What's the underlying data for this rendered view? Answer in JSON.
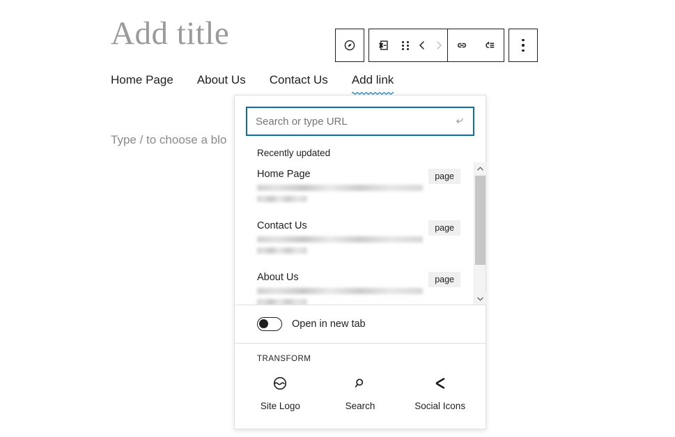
{
  "editor": {
    "post_title_placeholder": "Add title",
    "paragraph_placeholder": "Type / to choose a blo"
  },
  "navigation_block": {
    "items": [
      {
        "label": "Home Page",
        "active": false
      },
      {
        "label": "About Us",
        "active": false
      },
      {
        "label": "Contact Us",
        "active": false
      },
      {
        "label": "Add link",
        "active": true
      }
    ]
  },
  "block_toolbar": {
    "buttons": [
      {
        "name": "navigation-mode-icon",
        "title": "Navigation block"
      },
      {
        "name": "block-type-navigation-link-icon",
        "title": "Custom Link"
      },
      {
        "name": "drag-handle-icon",
        "title": "Drag"
      },
      {
        "name": "move-left-icon",
        "title": "Move left"
      },
      {
        "name": "move-right-icon",
        "title": "Move right"
      },
      {
        "name": "link-icon",
        "title": "Link"
      },
      {
        "name": "add-submenu-icon",
        "title": "Add submenu"
      },
      {
        "name": "more-options-icon",
        "title": "Options"
      }
    ]
  },
  "link_popover": {
    "search": {
      "placeholder": "Search or type URL",
      "value": "",
      "submit_icon": "enter-arrow-icon"
    },
    "results_heading": "Recently updated",
    "results": [
      {
        "title": "Home Page",
        "badge": "page",
        "url_redacted": true
      },
      {
        "title": "Contact Us",
        "badge": "page",
        "url_redacted": true
      },
      {
        "title": "About Us",
        "badge": "page",
        "url_redacted": true
      }
    ],
    "scrollbar": {
      "up_icon": "chevron-up-icon",
      "down_icon": "chevron-down-icon"
    },
    "new_tab": {
      "label": "Open in new tab",
      "enabled": false
    },
    "transform": {
      "heading": "TRANSFORM",
      "options": [
        {
          "label": "Site Logo",
          "icon": "site-logo-icon"
        },
        {
          "label": "Search",
          "icon": "search-icon"
        },
        {
          "label": "Social Icons",
          "icon": "social-icons-icon"
        }
      ]
    }
  },
  "colors": {
    "accent_blue": "#0a6fa8",
    "text": "#1e1e1e",
    "muted_text": "#757575",
    "title_placeholder": "#9a9a9a",
    "badge_bg": "#f0f0f0",
    "border": "#e0e0e0"
  }
}
